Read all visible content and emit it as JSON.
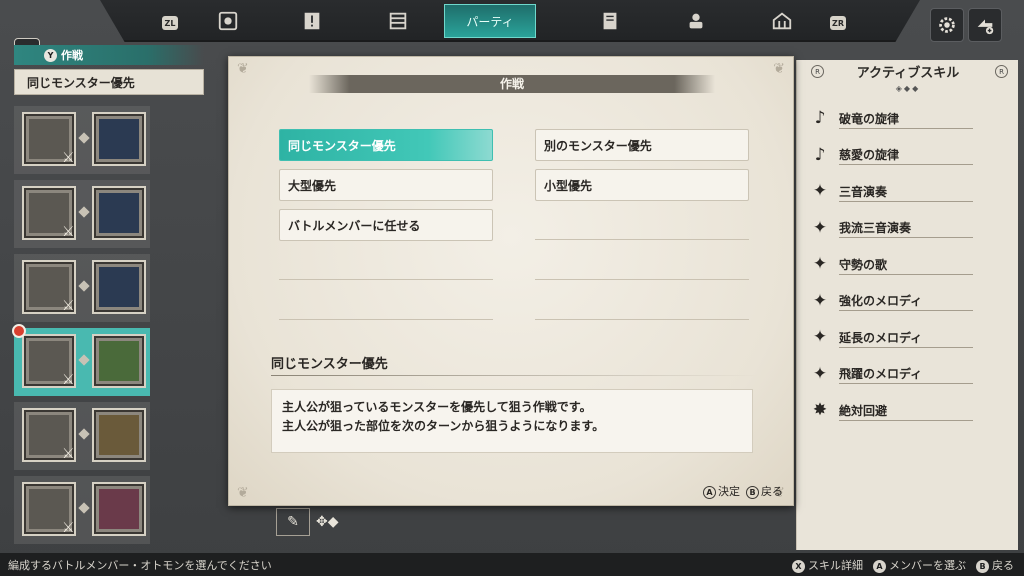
{
  "topbar": {
    "zl": "ZL",
    "zr": "ZR",
    "tabs": [
      {
        "icon": "cube-icon"
      },
      {
        "icon": "exclamation-icon"
      },
      {
        "icon": "book-icon"
      },
      {
        "label": "パーティ",
        "icon": "party-icon"
      },
      {
        "icon": "notebook-icon"
      },
      {
        "icon": "robot-icon"
      },
      {
        "icon": "stable-icon"
      }
    ]
  },
  "left_panel": {
    "header_button": "Y",
    "header": "作戦",
    "sub": "同じモンスター優先"
  },
  "modal": {
    "title": "作戦",
    "options_left": [
      "同じモンスター優先",
      "大型優先",
      "バトルメンバーに任せる"
    ],
    "options_right": [
      "別のモンスター優先",
      "小型優先"
    ],
    "selected": "同じモンスター優先",
    "desc_title": "同じモンスター優先",
    "desc_line1": "主人公が狙っているモンスターを優先して狙う作戦です。",
    "desc_line2": "主人公が狙った部位を次のターンから狙うようになります。",
    "hint_a_btn": "A",
    "hint_a": "決定",
    "hint_b_btn": "B",
    "hint_b": "戻る"
  },
  "right_panel": {
    "title": "アクティブスキル",
    "r_left": "R",
    "r_right": "R",
    "skills": [
      {
        "icon": "music-note-icon",
        "label": "破竜の旋律"
      },
      {
        "icon": "music-note-icon",
        "label": "慈愛の旋律"
      },
      {
        "icon": "sparkle-icon",
        "label": "三音演奏"
      },
      {
        "icon": "sparkle-icon",
        "label": "我流三音演奏"
      },
      {
        "icon": "sparkle-icon",
        "label": "守勢の歌"
      },
      {
        "icon": "sparkle-icon",
        "label": "強化のメロディ"
      },
      {
        "icon": "sparkle-icon",
        "label": "延長のメロディ"
      },
      {
        "icon": "sparkle-icon",
        "label": "飛躍のメロディ"
      },
      {
        "icon": "dodge-icon",
        "label": "絶対回避"
      }
    ]
  },
  "footer": {
    "message": "編成するバトルメンバー・オトモンを選んでください",
    "x_btn": "X",
    "x_label": "スキル詳細",
    "a_btn": "A",
    "a_label": "メンバーを選ぶ",
    "b_btn": "B",
    "b_label": "戻る"
  },
  "colors": {
    "accent": "#2eb3a4",
    "selected_row": "#49b9b0",
    "alert_dot": "#d8402f"
  }
}
